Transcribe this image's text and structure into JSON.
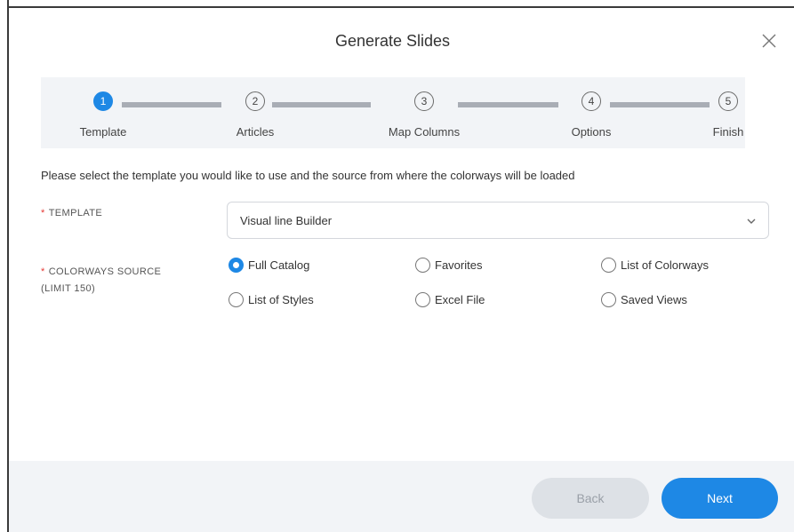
{
  "dialog": {
    "title": "Generate Slides"
  },
  "steps": [
    {
      "number": "1",
      "label": "Template"
    },
    {
      "number": "2",
      "label": "Articles"
    },
    {
      "number": "3",
      "label": "Map Columns"
    },
    {
      "number": "4",
      "label": "Options"
    },
    {
      "number": "5",
      "label": "Finish"
    }
  ],
  "active_step": 1,
  "instruction": "Please select the template you would like to use and the source from where the colorways will be loaded",
  "template_field": {
    "required_mark": "*",
    "label": "TEMPLATE",
    "value": "Visual line Builder"
  },
  "colorways_field": {
    "required_mark": "*",
    "label_line1": "COLORWAYS SOURCE",
    "label_line2": "(LIMIT 150)",
    "options": [
      {
        "label": "Full Catalog",
        "checked": true
      },
      {
        "label": "Favorites",
        "checked": false
      },
      {
        "label": "List of Colorways",
        "checked": false
      },
      {
        "label": "List of Styles",
        "checked": false
      },
      {
        "label": "Excel File",
        "checked": false
      },
      {
        "label": "Saved Views",
        "checked": false
      }
    ]
  },
  "buttons": {
    "back": "Back",
    "next": "Next"
  },
  "colors": {
    "accent": "#1e88e5",
    "stepper_bg": "#f2f4f7",
    "required": "#e53935"
  }
}
